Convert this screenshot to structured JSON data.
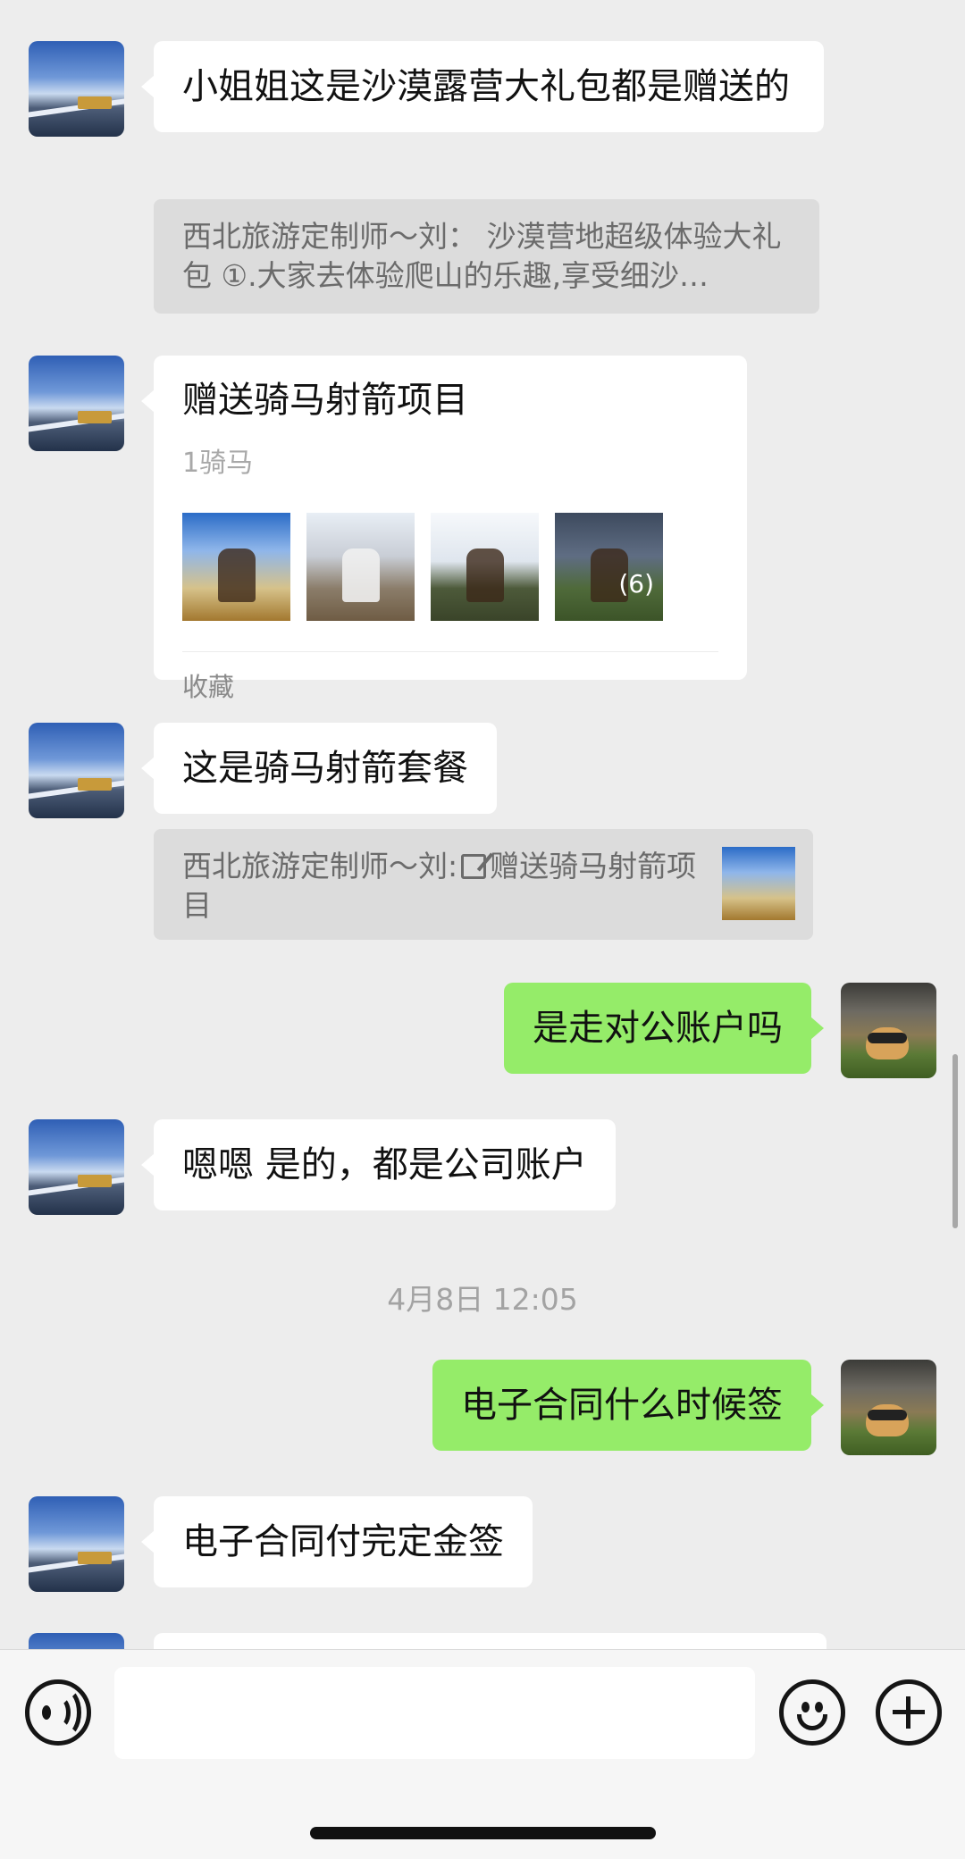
{
  "messages": {
    "m1": {
      "text": "小姐姐这是沙漠露营大礼包都是赠送的"
    },
    "q1": {
      "text": "西北旅游定制师～刘： 沙漠营地超级体验大礼包 ①.大家去体验爬山的乐趣,享受细沙…"
    },
    "card": {
      "title": "赠送骑马射箭项目",
      "subtitle": "1骑马",
      "more_count": "(6)",
      "footer": "收藏"
    },
    "m2": {
      "text": "这是骑马射箭套餐"
    },
    "q2": {
      "sender": "西北旅游定制师～刘:",
      "text": "赠送骑马射箭项目"
    },
    "m3": {
      "text": "是走对公账户吗"
    },
    "m4": {
      "text": "嗯嗯 是的，都是公司账户"
    },
    "timestamp": "4月8日 12:05",
    "m5": {
      "text": "电子合同什么时候签"
    },
    "m6": {
      "text": "电子合同付完定金签"
    }
  },
  "input_bar": {
    "placeholder": "",
    "icons": [
      "voice-icon",
      "emoji-icon",
      "plus-icon"
    ]
  },
  "colors": {
    "background": "#ededed",
    "incoming_bubble": "#ffffff",
    "outgoing_bubble": "#95ec69",
    "quote_bg": "#dcdcdc"
  }
}
